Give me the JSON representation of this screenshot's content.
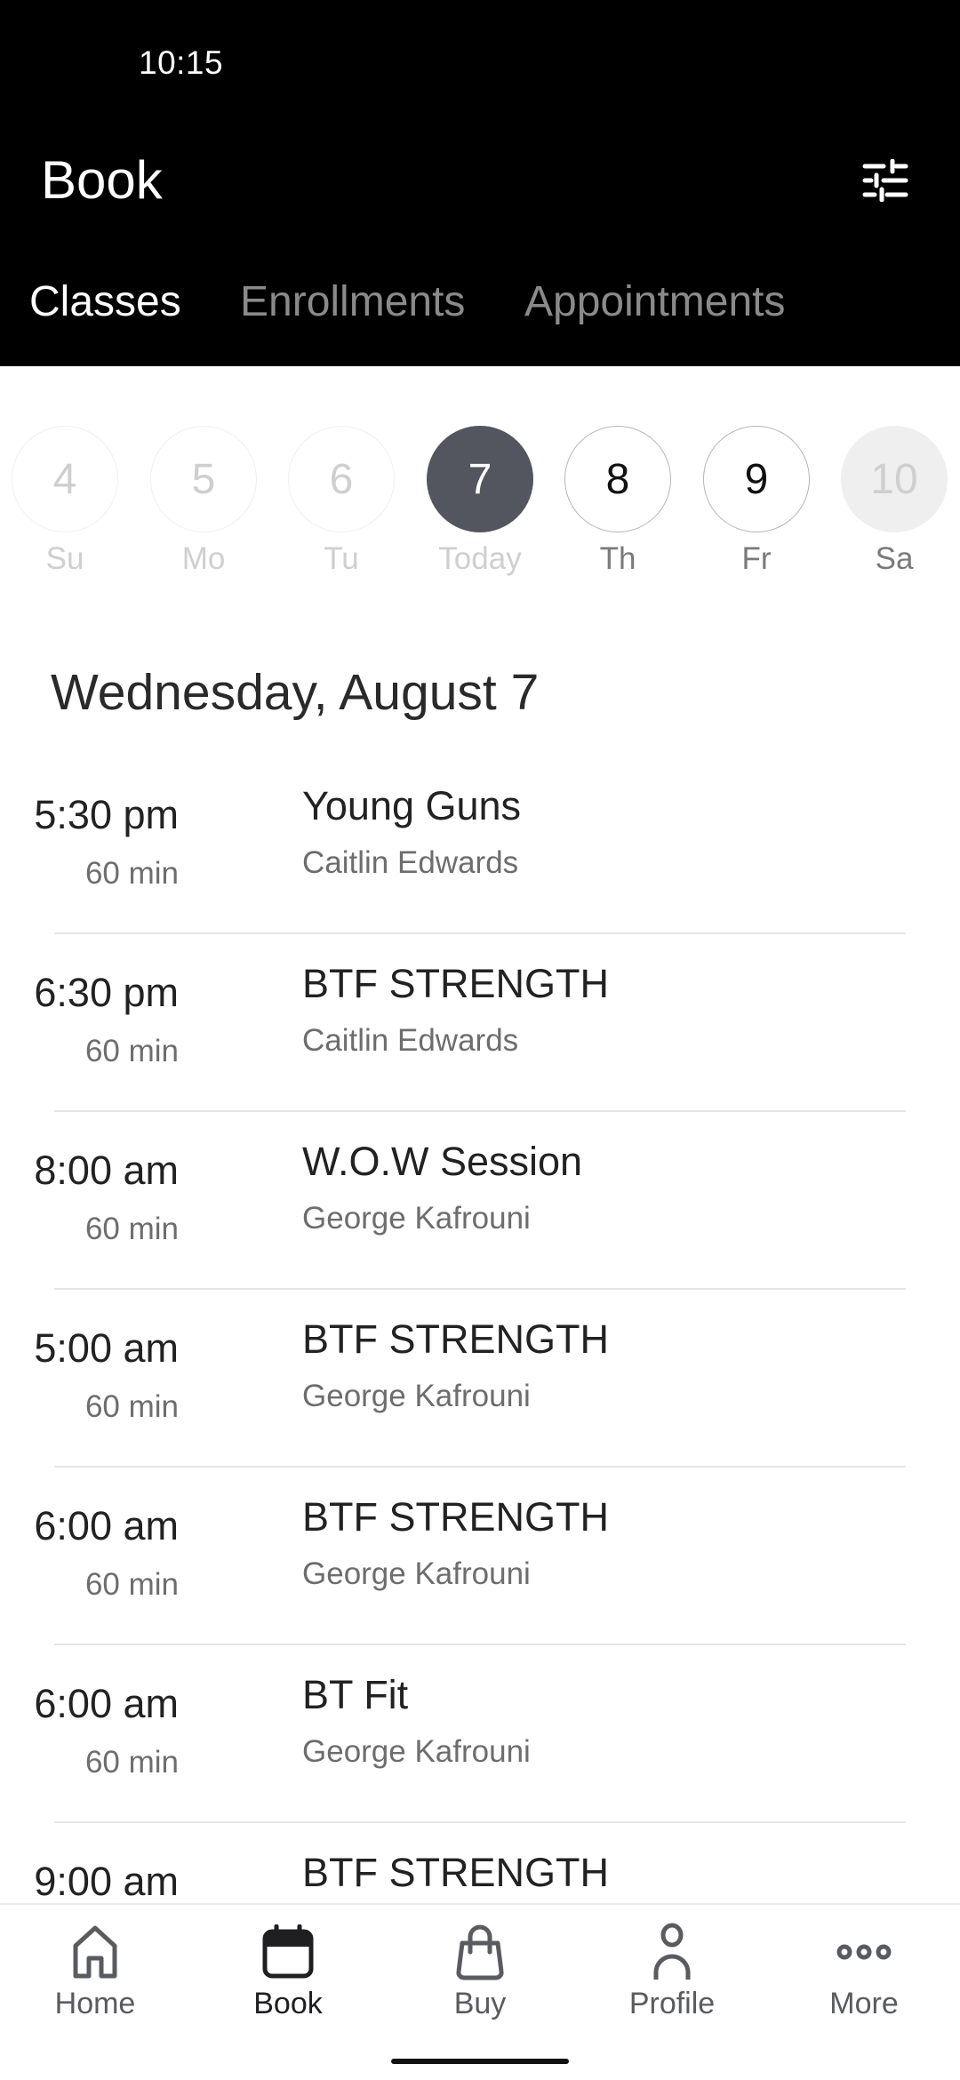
{
  "status_bar": {
    "time": "10:15"
  },
  "header": {
    "title": "Book",
    "filter_icon": "sliders-icon"
  },
  "tabs": [
    {
      "label": "Classes",
      "active": true
    },
    {
      "label": "Enrollments",
      "active": false
    },
    {
      "label": "Appointments",
      "active": false
    }
  ],
  "date_strip": {
    "days": [
      {
        "number": "4",
        "label": "Su",
        "state": "past"
      },
      {
        "number": "5",
        "label": "Mo",
        "state": "past"
      },
      {
        "number": "6",
        "label": "Tu",
        "state": "past"
      },
      {
        "number": "7",
        "label": "Today",
        "state": "selected"
      },
      {
        "number": "8",
        "label": "Th",
        "state": "future"
      },
      {
        "number": "9",
        "label": "Fr",
        "state": "future"
      },
      {
        "number": "10",
        "label": "Sa",
        "state": "disabled"
      }
    ],
    "selected_color": "#53565e"
  },
  "date_heading": "Wednesday, August 7",
  "classes": [
    {
      "time": "5:30 pm",
      "duration": "60 min",
      "name": "Young Guns",
      "instructor": "Caitlin Edwards"
    },
    {
      "time": "6:30 pm",
      "duration": "60 min",
      "name": "BTF STRENGTH",
      "instructor": "Caitlin Edwards"
    },
    {
      "time": "8:00 am",
      "duration": "60 min",
      "name": "W.O.W Session",
      "instructor": "George Kafrouni"
    },
    {
      "time": "5:00 am",
      "duration": "60 min",
      "name": "BTF STRENGTH",
      "instructor": "George Kafrouni"
    },
    {
      "time": "6:00 am",
      "duration": "60 min",
      "name": "BTF STRENGTH",
      "instructor": "George Kafrouni"
    },
    {
      "time": "6:00 am",
      "duration": "60 min",
      "name": "BT Fit",
      "instructor": "George Kafrouni"
    },
    {
      "time": "9:00 am",
      "duration": "",
      "name": "BTF STRENGTH",
      "instructor": ""
    }
  ],
  "bottom_nav": [
    {
      "label": "Home",
      "icon": "home-icon",
      "active": false
    },
    {
      "label": "Book",
      "icon": "calendar-icon",
      "active": true
    },
    {
      "label": "Buy",
      "icon": "shopping-bag-icon",
      "active": false
    },
    {
      "label": "Profile",
      "icon": "person-icon",
      "active": false
    },
    {
      "label": "More",
      "icon": "more-icon",
      "active": false
    }
  ]
}
